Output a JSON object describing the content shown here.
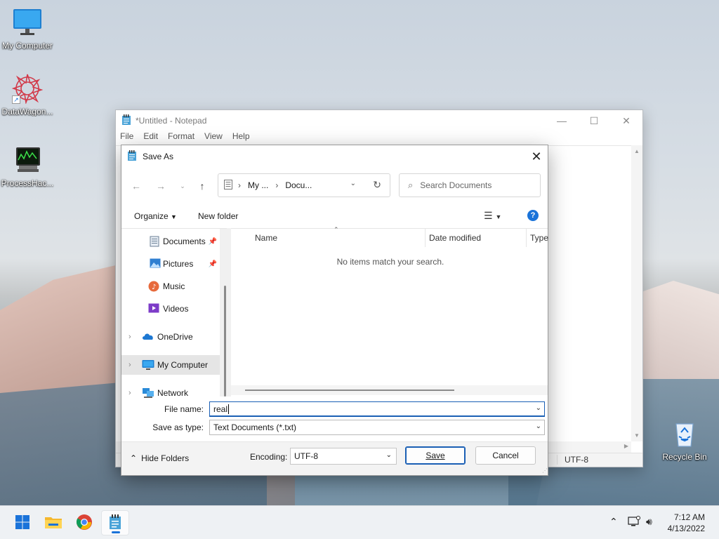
{
  "desktop": {
    "icons": [
      {
        "label": "My Computer",
        "icon": "monitor-icon"
      },
      {
        "label": "DataWagon...",
        "icon": "datawagon-icon"
      },
      {
        "label": "ProcessHac...",
        "icon": "processhacker-icon"
      },
      {
        "label": "Recycle Bin",
        "icon": "recycle-bin-icon"
      }
    ]
  },
  "notepad": {
    "title": "*Untitled - Notepad",
    "menu": [
      "File",
      "Edit",
      "Format",
      "View",
      "Help"
    ],
    "controls": {
      "minimize": "—",
      "maximize": "☐",
      "close": "✕"
    },
    "status_encoding": "UTF-8"
  },
  "dialog": {
    "title": "Save As",
    "close": "✕",
    "address": {
      "part1": "My ...",
      "part2": "Docu..."
    },
    "search_placeholder": "Search Documents",
    "toolbar": {
      "organize": "Organize",
      "new_folder": "New folder",
      "help": "?"
    },
    "sidebar": [
      {
        "label": "Documents",
        "icon": "documents-icon",
        "pinned": true
      },
      {
        "label": "Pictures",
        "icon": "pictures-icon",
        "pinned": true
      },
      {
        "label": "Music",
        "icon": "music-icon"
      },
      {
        "label": "Videos",
        "icon": "videos-icon"
      },
      {
        "label": "OneDrive",
        "icon": "onedrive-icon",
        "expandable": true
      },
      {
        "label": "My Computer",
        "icon": "monitor-icon",
        "expandable": true,
        "selected": true
      },
      {
        "label": "Network",
        "icon": "network-icon",
        "expandable": true
      }
    ],
    "columns": [
      "Name",
      "Date modified",
      "Type"
    ],
    "empty_message": "No items match your search.",
    "file_name_label": "File name:",
    "file_name_value": "real",
    "save_type_label": "Save as type:",
    "save_type_value": "Text Documents (*.txt)",
    "hide_folders": "Hide Folders",
    "encoding_label": "Encoding:",
    "encoding_value": "UTF-8",
    "save_button": "Save",
    "cancel_button": "Cancel"
  },
  "taskbar": {
    "time": "7:12 AM",
    "date": "4/13/2022"
  },
  "colors": {
    "accent": "#1a73d9",
    "focus_border": "#1a5fb4"
  }
}
